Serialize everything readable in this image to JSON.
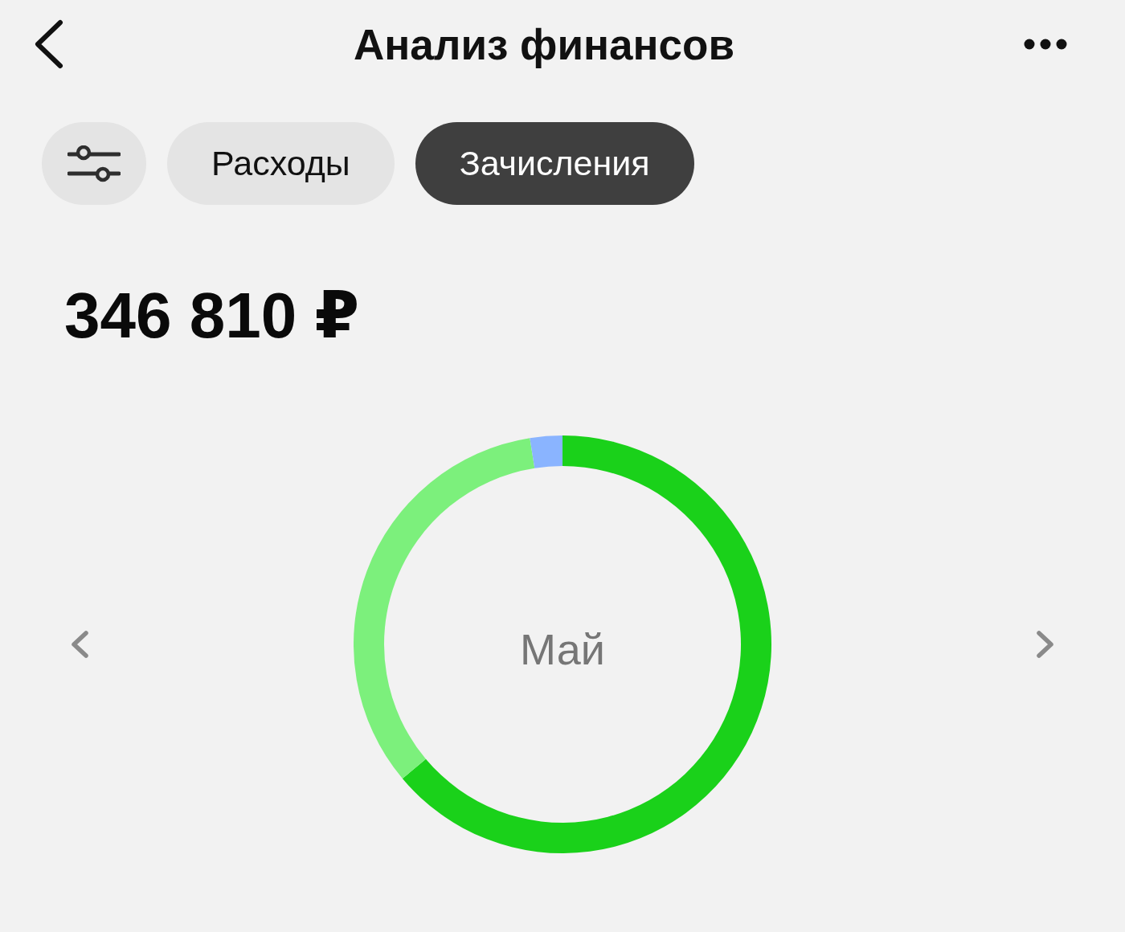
{
  "header": {
    "title": "Анализ финансов"
  },
  "tabs": [
    {
      "label": "Расходы",
      "selected": false
    },
    {
      "label": "Зачисления",
      "selected": true
    }
  ],
  "total": {
    "amount": "346 810 ₽"
  },
  "period": {
    "label": "Май"
  }
}
